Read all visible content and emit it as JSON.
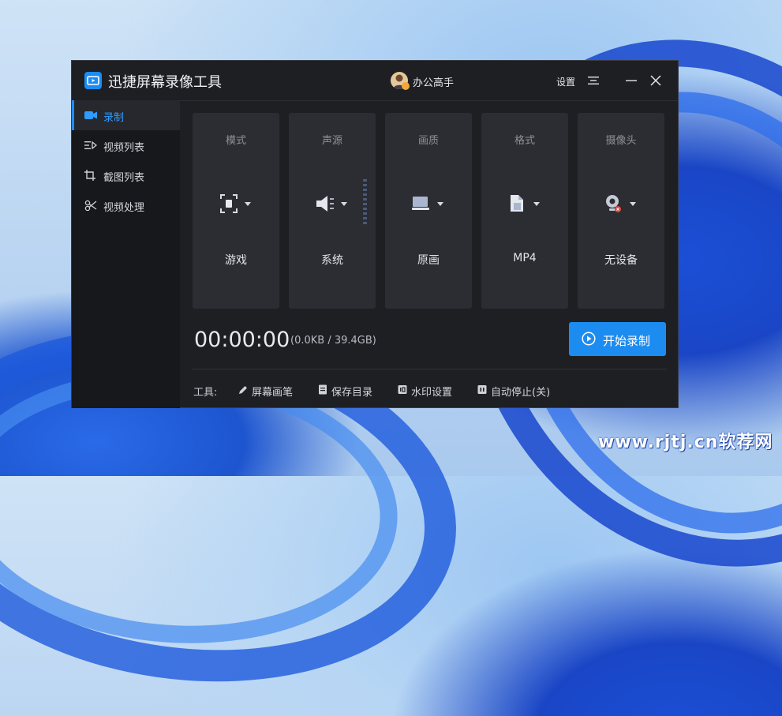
{
  "window": {
    "app_title": "迅捷屏幕录像工具",
    "user_name": "办公高手",
    "settings_label": "设置"
  },
  "sidebar": {
    "items": [
      {
        "label": "录制",
        "icon": "video-camera-icon",
        "active": true
      },
      {
        "label": "视频列表",
        "icon": "video-list-icon",
        "active": false
      },
      {
        "label": "截图列表",
        "icon": "screenshot-list-icon",
        "active": false
      },
      {
        "label": "视频处理",
        "icon": "video-processing-icon",
        "active": false
      }
    ]
  },
  "cards": [
    {
      "title": "模式",
      "value": "游戏",
      "icon": "capture-mode-icon"
    },
    {
      "title": "声源",
      "value": "系统",
      "icon": "speaker-icon"
    },
    {
      "title": "画质",
      "value": "原画",
      "icon": "monitor-icon"
    },
    {
      "title": "格式",
      "value": "MP4",
      "icon": "file-format-icon"
    },
    {
      "title": "摄像头",
      "value": "无设备",
      "icon": "webcam-off-icon"
    }
  ],
  "status": {
    "timer": "00:00:00",
    "storage": "(0.0KB / 39.4GB)"
  },
  "start_button": {
    "label": "开始录制"
  },
  "tools": {
    "label": "工具:",
    "items": [
      {
        "label": "屏幕画笔",
        "icon": "pen-icon"
      },
      {
        "label": "保存目录",
        "icon": "folder-doc-icon"
      },
      {
        "label": "水印设置",
        "icon": "watermark-icon"
      },
      {
        "label": "自动停止(关)",
        "icon": "pause-icon"
      }
    ]
  },
  "watermark": "www.rjtj.cn软荐网",
  "colors": {
    "accent": "#1d8cf0",
    "window_bg": "#1e1f23",
    "card_bg": "#2b2d32",
    "sidebar_bg": "#17181b",
    "active_text": "#2f9bff"
  }
}
